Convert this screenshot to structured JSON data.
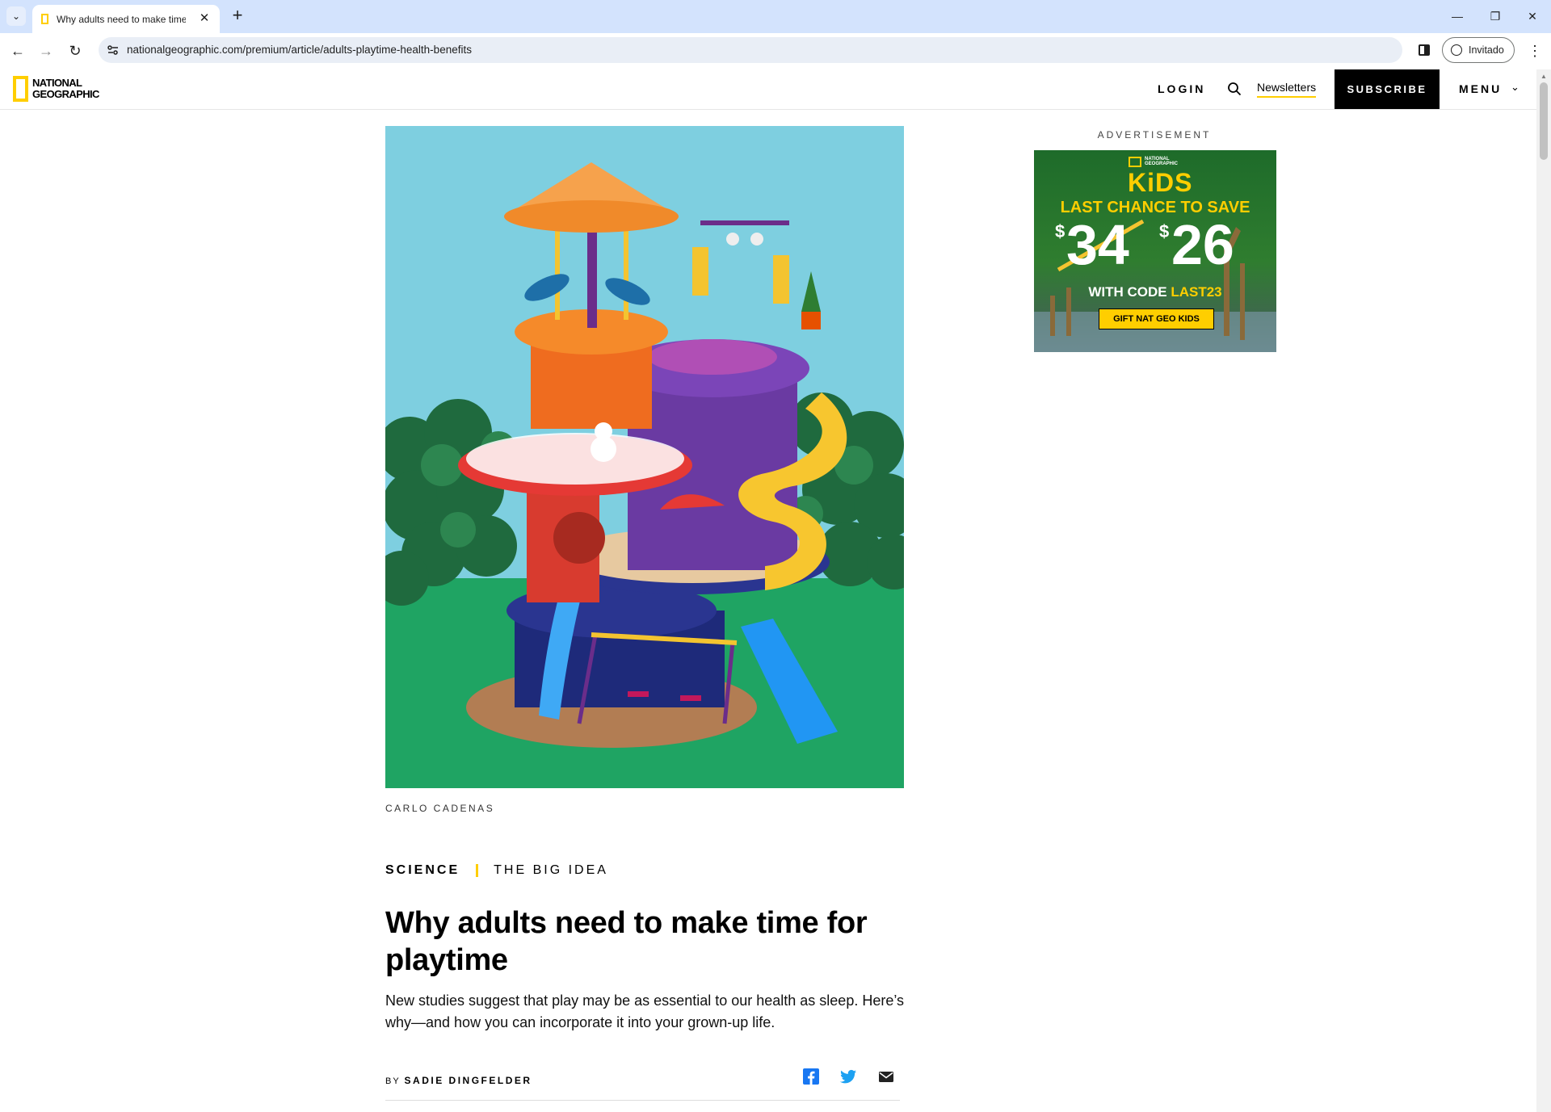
{
  "browser": {
    "tab_title": "Why adults need to make time",
    "url": "nationalgeographic.com/premium/article/adults-playtime-health-benefits",
    "profile_label": "Invitado"
  },
  "header": {
    "logo_line1": "NATIONAL",
    "logo_line2": "GEOGRAPHIC",
    "login": "LOGIN",
    "newsletters": "Newsletters",
    "subscribe": "SUBSCRIBE",
    "menu": "MENU"
  },
  "hero": {
    "credit": "CARLO CADENAS"
  },
  "ad": {
    "label": "ADVERTISEMENT",
    "brand_small": "NATIONAL GEOGRAPHIC",
    "brand": "KiDS",
    "headline": "LAST CHANCE TO SAVE",
    "old_price": "34",
    "new_price": "26",
    "currency": "$",
    "code_prefix": "WITH CODE ",
    "code": "LAST23",
    "cta": "GIFT NAT GEO KIDS"
  },
  "article": {
    "category": "SCIENCE",
    "series": "THE BIG IDEA",
    "title": "Why adults need to make time for playtime",
    "dek": "New studies suggest that play may be as essential to our health as sleep. Here’s why—and how you can incorporate it into your grown-up life.",
    "byline_prefix": "BY ",
    "author": "SADIE DINGFELDER"
  },
  "colors": {
    "accent": "#ffce00",
    "chrome_tab": "#d3e3fd",
    "sky": "#7ecfe0",
    "grass": "#1fa463"
  }
}
